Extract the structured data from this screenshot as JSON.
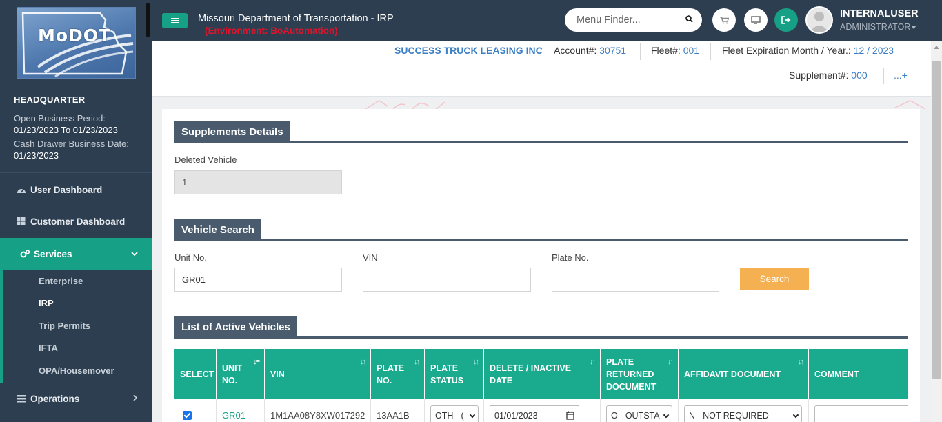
{
  "sidebar": {
    "logo_text": "MoDOT",
    "office": "HEADQUARTER",
    "open_period_label": "Open Business Period:",
    "open_period_value": "01/23/2023 To 01/23/2023",
    "cash_drawer_label": "Cash Drawer Business Date:",
    "cash_drawer_value": "01/23/2023",
    "nav": [
      {
        "label": "User Dashboard",
        "icon": "dashboard-icon"
      },
      {
        "label": "Customer Dashboard",
        "icon": "grid-icon"
      },
      {
        "label": "Services",
        "icon": "gears-icon",
        "active": true,
        "expanded": true
      },
      {
        "label": "Operations",
        "icon": "list-icon"
      }
    ],
    "services_items": [
      "Enterprise",
      "IRP",
      "Trip Permits",
      "IFTA",
      "OPA/Housemover"
    ],
    "active_service": "IRP"
  },
  "header": {
    "title": "Missouri Department of Transportation - IRP",
    "environment": "(Environment: BoAutomation)",
    "menu_finder_placeholder": "Menu Finder...",
    "user_name": "INTERNALUSER",
    "user_role": "ADMINISTRATOR",
    "icons": [
      "cart-icon",
      "monitor-icon",
      "logout-icon"
    ]
  },
  "account": {
    "company": "SUCCESS TRUCK LEASING INC",
    "account_label": "Account#:",
    "account_value": "30751",
    "fleet_label": "Fleet#:",
    "fleet_value": "001",
    "expiration_label": "Fleet Expiration Month / Year.:",
    "expiration_value": "12 / 2023",
    "supplement_label": "Supplement#:",
    "supplement_value": "000",
    "more": "...+"
  },
  "supplements": {
    "title": "Supplements Details",
    "deleted_vehicle_label": "Deleted Vehicle",
    "deleted_vehicle_value": "1"
  },
  "vehicle_search": {
    "title": "Vehicle Search",
    "unit_label": "Unit No.",
    "unit_value": "GR01",
    "vin_label": "VIN",
    "vin_value": "",
    "plate_label": "Plate No.",
    "plate_value": "",
    "search_button": "Search"
  },
  "active_vehicles": {
    "title": "List of Active Vehicles",
    "columns": [
      "SELECT",
      "UNIT NO.",
      "VIN",
      "PLATE NO.",
      "PLATE STATUS",
      "DELETE / INACTIVE DATE",
      "PLATE RETURNED DOCUMENT",
      "AFFIDAVIT DOCUMENT",
      "COMMENT"
    ],
    "rows": [
      {
        "selected": true,
        "unit_no": "GR01",
        "vin": "1M1AA08Y8XW017292",
        "plate_no": "13AA1B",
        "plate_status": "OTH - (",
        "delete_date": "01/01/2023",
        "plate_returned": "O - OUTSTA",
        "affidavit": "N - NOT REQUIRED",
        "comment": ""
      }
    ]
  },
  "colors": {
    "sidebar_bg": "#2c3e50",
    "accent_green": "#16a085",
    "section_header": "#4a5b6d",
    "link_blue": "#3b7fc4",
    "env_red": "#e0142b",
    "search_orange": "#f5b051"
  }
}
